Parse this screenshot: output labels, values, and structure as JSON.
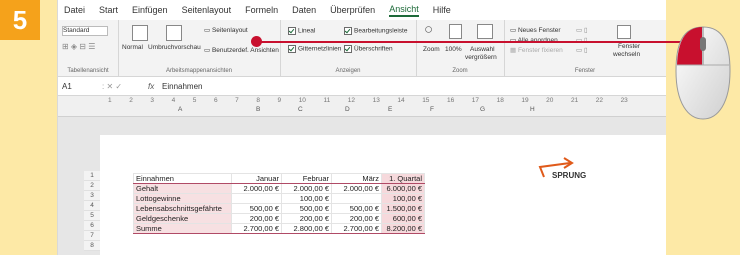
{
  "step": "5",
  "menu": [
    "Datei",
    "Start",
    "Einfügen",
    "Seitenlayout",
    "Formeln",
    "Daten",
    "Überprüfen",
    "Ansicht",
    "Hilfe"
  ],
  "menu_active": "Ansicht",
  "ribbon": {
    "standard": "Standard",
    "normal": "Normal",
    "umbruch": "Umbruchvorschau",
    "seitenlayout": "Seitenlayout",
    "benutzerdef": "Benutzerdef. Ansichten",
    "lineal": "Lineal",
    "bearbeitungsleiste": "Bearbeitungsleiste",
    "gitternetzlinien": "Gitternetzlinien",
    "ueberschriften": "Überschriften",
    "zoom": "Zoom",
    "hundert": "100%",
    "auswahl1": "Auswahl",
    "auswahl2": "vergrößern",
    "neues_fenster": "Neues Fenster",
    "alle_anordnen": "Alle anordnen",
    "fenster_fixieren": "Fenster fixieren",
    "fenster_wechseln1": "Fenster",
    "fenster_wechseln2": "wechseln",
    "label_blatt": "Tabellenansicht",
    "label_arbeitsmappe": "Arbeitsmappenansichten",
    "label_anzeigen": "Anzeigen",
    "label_zoom": "Zoom",
    "label_fenster": "Fenster"
  },
  "formula": {
    "cell": "A1",
    "fx": "fx",
    "value": "Einnahmen"
  },
  "ruler_nums": [
    "1",
    "2",
    "3",
    "4",
    "5",
    "6",
    "7",
    "8",
    "9",
    "10",
    "11",
    "12",
    "13",
    "14",
    "15",
    "16",
    "17",
    "18",
    "19",
    "20",
    "21",
    "22",
    "23"
  ],
  "columns": [
    "A",
    "B",
    "C",
    "D",
    "E",
    "F",
    "G",
    "H"
  ],
  "row_nums": [
    "1",
    "2",
    "3",
    "4",
    "5",
    "6",
    "7",
    "8"
  ],
  "table": {
    "header": [
      "Einnahmen",
      "Januar",
      "Februar",
      "März",
      "1. Quartal"
    ],
    "rows": [
      [
        "Gehalt",
        "2.000,00 €",
        "2.000,00 €",
        "2.000,00 €",
        "6.000,00 €"
      ],
      [
        "Lottogewinne",
        "",
        "100,00 €",
        "",
        "100,00 €"
      ],
      [
        "Lebensabschnittsgefährte",
        "500,00 €",
        "500,00 €",
        "500,00 €",
        "1.500,00 €"
      ],
      [
        "Geldgeschenke",
        "200,00 €",
        "200,00 €",
        "200,00 €",
        "600,00 €"
      ]
    ],
    "sum": [
      "Summe",
      "2.700,00 €",
      "2.800,00 €",
      "2.700,00 €",
      "8.200,00 €"
    ]
  },
  "sprung": "SPRUNG"
}
